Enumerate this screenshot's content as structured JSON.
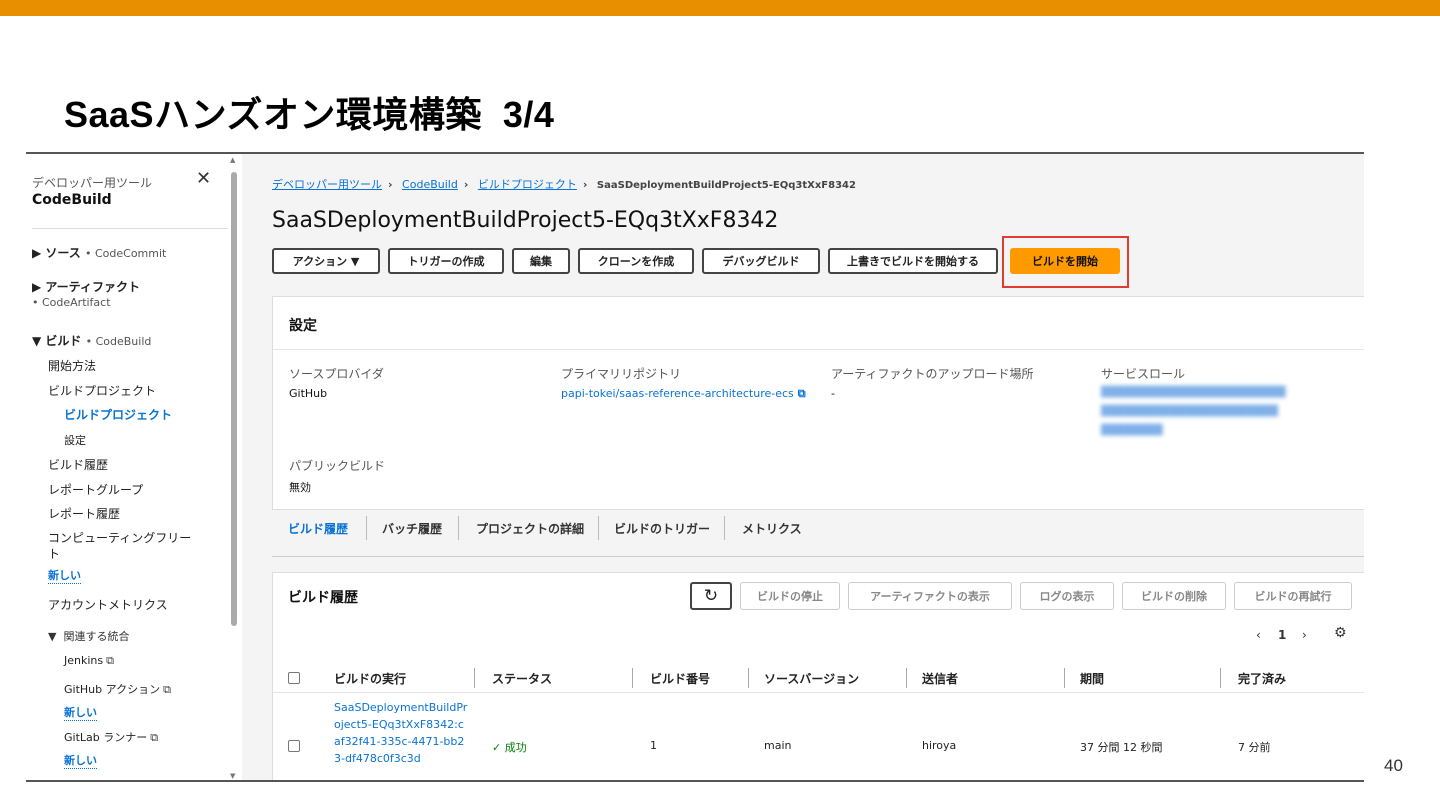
{
  "slide": {
    "title": "SaaSハンズオン環境構築",
    "step": "3/4",
    "page_number": "40",
    "accent_color": "#e88f00"
  },
  "sidebar": {
    "header_small": "デベロッパー用ツール",
    "title": "CodeBuild",
    "close_icon": "close-icon",
    "source": {
      "label": "ソース",
      "sub": "• CodeCommit"
    },
    "artifacts": {
      "label": "アーティファクト",
      "sub": "• CodeArtifact"
    },
    "build": {
      "label": "ビルド",
      "sub": "• CodeBuild"
    },
    "items": [
      {
        "label": "開始方法"
      },
      {
        "label": "ビルドプロジェクト"
      },
      {
        "label": "ビルドプロジェクト"
      },
      {
        "label": "設定"
      },
      {
        "label": "ビルド履歴"
      },
      {
        "label": "レポートグループ"
      },
      {
        "label": "レポート履歴"
      },
      {
        "label": "コンピューティングフリート"
      },
      {
        "label": "アカウントメトリクス"
      }
    ],
    "new_label": "新しい",
    "related": {
      "label": "関連する統合",
      "items": [
        {
          "label": "Jenkins"
        },
        {
          "label": "GitHub アクション"
        },
        {
          "label": "GitLab ランナー"
        }
      ]
    }
  },
  "breadcrumbs": [
    {
      "label": "デベロッパー用ツール"
    },
    {
      "label": "CodeBuild"
    },
    {
      "label": "ビルドプロジェクト"
    },
    {
      "label": "SaaSDeploymentBuildProject5-EQq3tXxF8342"
    }
  ],
  "project_title": "SaaSDeploymentBuildProject5-EQq3tXxF8342",
  "actions": {
    "action": "アクション ▼",
    "create_trigger": "トリガーの作成",
    "edit": "編集",
    "clone": "クローンを作成",
    "debug": "デバッグビルド",
    "override_start": "上書きでビルドを開始する",
    "start_build": "ビルドを開始",
    "primary_color": "#ff9900",
    "highlight_color": "#e03c31"
  },
  "settings": {
    "title": "設定",
    "source_provider_label": "ソースプロバイダ",
    "source_provider_value": "GitHub",
    "primary_repo_label": "プライマリリポジトリ",
    "primary_repo_value": "papi-tokei/saas-reference-architecture-ecs",
    "artifact_upload_label": "アーティファクトのアップロード場所",
    "artifact_upload_value": "-",
    "service_role_label": "サービスロール",
    "public_build_label": "パブリックビルド",
    "public_build_value": "無効"
  },
  "tabs": [
    "ビルド履歴",
    "バッチ履歴",
    "プロジェクトの詳細",
    "ビルドのトリガー",
    "メトリクス"
  ],
  "history": {
    "title": "ビルド履歴",
    "refresh_icon": "refresh-icon",
    "buttons": [
      "ビルドの停止",
      "アーティファクトの表示",
      "ログの表示",
      "ビルドの削除",
      "ビルドの再試行"
    ],
    "page": "1",
    "columns": [
      "ビルドの実行",
      "ステータス",
      "ビルド番号",
      "ソースバージョン",
      "送信者",
      "期間",
      "完了済み"
    ],
    "rows": [
      {
        "run": "SaaSDeploymentBuildProject5-EQq3tXxF8342:caf32f41-335c-4471-bb23-df478c0f3c3d",
        "status": "成功",
        "number": "1",
        "source_version": "main",
        "submitter": "hiroya",
        "duration": "37 分間 12 秒間",
        "completed": "7 分前"
      }
    ]
  }
}
